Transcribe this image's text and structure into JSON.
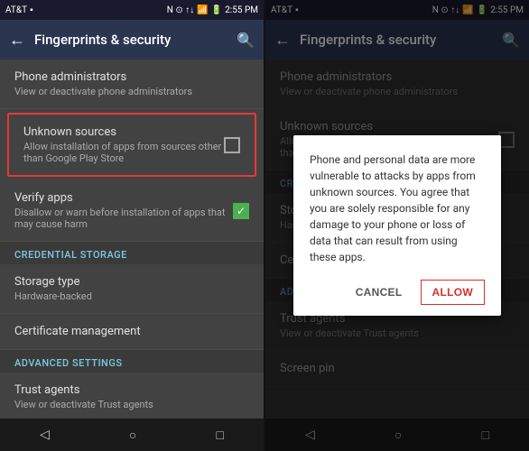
{
  "statusBar": {
    "carrier": "AT&T",
    "time": "2:55 PM",
    "icons": "N ⊙ ⏱ ↑↓ 📶 🔋"
  },
  "topBar": {
    "backIcon": "←",
    "title": "Fingerprints & security",
    "searchIcon": "🔍"
  },
  "settings": [
    {
      "id": "phone-admin",
      "title": "Phone administrators",
      "subtitle": "View or deactivate phone administrators",
      "hasCheckbox": false,
      "highlighted": false
    },
    {
      "id": "unknown-sources",
      "title": "Unknown sources",
      "subtitle": "Allow installation of apps from sources other than Google Play Store",
      "hasCheckbox": true,
      "checked": false,
      "highlighted": true
    }
  ],
  "credentialStorage": {
    "sectionLabel": "CREDENTIAL STORAGE",
    "storageType": {
      "title": "Storage type",
      "subtitle": "Hardware-backed"
    },
    "certificateManagement": {
      "title": "Certificate management"
    }
  },
  "advancedSettings": {
    "sectionLabel": "ADVANCED SETTINGS",
    "trustAgents": {
      "title": "Trust agents",
      "subtitle": "View or deactivate Trust agents"
    },
    "screenPin": {
      "title": "Screen pin"
    }
  },
  "navBar": {
    "backIcon": "◁",
    "homeIcon": "○",
    "recentIcon": "□"
  },
  "dialog": {
    "text": "Phone and personal data are more vulnerable to attacks by apps from unknown sources. You agree that you are solely responsible for any damage to your phone or loss of data that can result from using these apps.",
    "cancelLabel": "CANCEL",
    "allowLabel": "ALLOW"
  }
}
